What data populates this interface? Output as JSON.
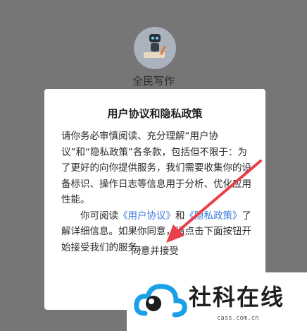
{
  "app": {
    "name": "全民写作",
    "avatar_icon": "robot-writer-icon"
  },
  "dialog": {
    "title": "用户协议和隐私政策",
    "paragraph1": "请你务必审慎阅读、充分理解“用户协议”和“隐私政策”各条款，包括但不限于：为了更好的向你提供服务，我们需要收集你的设备标识、操作日志等信息用于分析、优化应用性能。",
    "p2_prefix": "你可阅读",
    "p2_link1": "《用户协议》",
    "p2_and": "和",
    "p2_link2": "《隐私政策》",
    "p2_suffix": "了解详细信息。如果你同意，请点击下面按钮开始接受我们的服务。",
    "accept_label": "同意并接受"
  },
  "watermark": {
    "text": "社科在线",
    "url": "cass.com.cn",
    "icon": "cloud-eye-logo"
  },
  "colors": {
    "overlay": "#767676",
    "link": "#3e7be0",
    "arrow": "#e8404a",
    "logo_blue": "#1aa0e8"
  }
}
